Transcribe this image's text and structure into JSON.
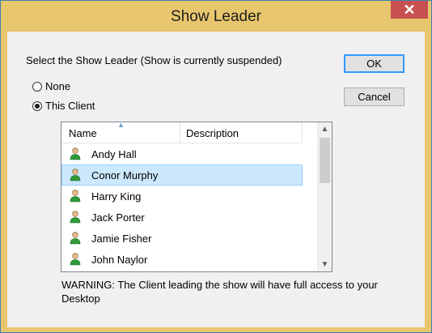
{
  "window": {
    "title": "Show Leader",
    "close_label": "✕"
  },
  "dialog": {
    "instruction": "Select the Show Leader (Show is currently suspended)",
    "ok_label": "OK",
    "cancel_label": "Cancel",
    "radio_none_label": "None",
    "radio_client_label": "This Client",
    "selected_radio": "This Client",
    "warning": "WARNING: The Client leading the show will have full access to your Desktop"
  },
  "list": {
    "columns": [
      "Name",
      "Description"
    ],
    "sort_column": "Name",
    "sort_direction": "ascending",
    "selected": "Conor Murphy",
    "rows": [
      {
        "name": "Andy Hall",
        "description": ""
      },
      {
        "name": "Conor Murphy",
        "description": ""
      },
      {
        "name": "Harry King",
        "description": ""
      },
      {
        "name": "Jack Porter",
        "description": ""
      },
      {
        "name": "Jamie Fisher",
        "description": ""
      },
      {
        "name": "John Naylor",
        "description": ""
      }
    ],
    "row_icon": "user-icon"
  },
  "colors": {
    "title_bar": "#e8c66d",
    "close_button": "#c75050",
    "selection": "#cce8ff"
  }
}
